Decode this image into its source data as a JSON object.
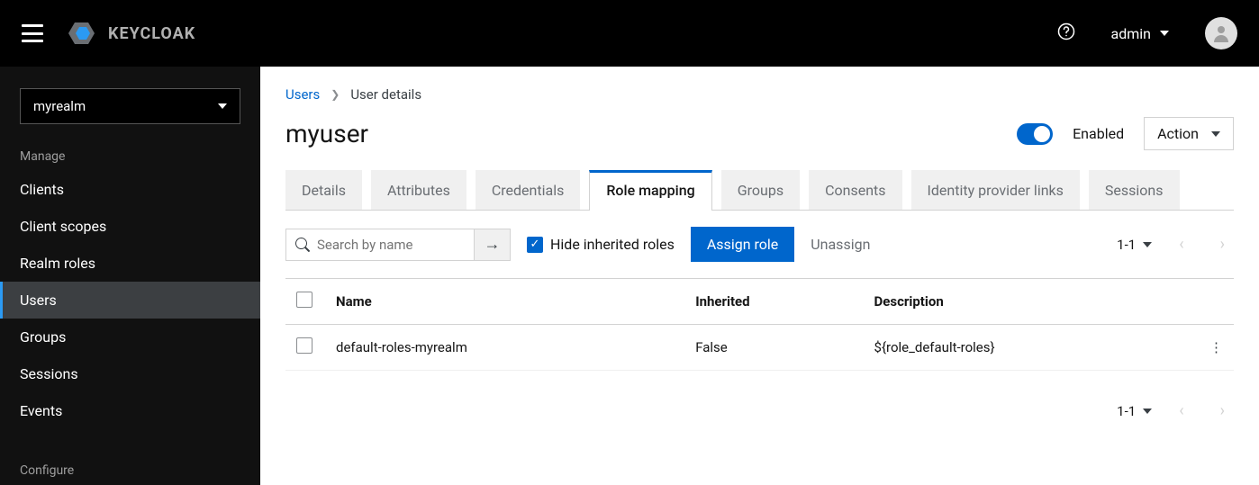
{
  "header": {
    "brand_text": "KEYCLOAK",
    "username": "admin"
  },
  "sidebar": {
    "realm": "myrealm",
    "sections": [
      {
        "heading": "Manage",
        "items": [
          "Clients",
          "Client scopes",
          "Realm roles",
          "Users",
          "Groups",
          "Sessions",
          "Events"
        ],
        "active": "Users"
      },
      {
        "heading": "Configure",
        "items": []
      }
    ]
  },
  "breadcrumb": {
    "link": "Users",
    "current": "User details"
  },
  "page": {
    "title": "myuser",
    "enabled_label": "Enabled",
    "action_label": "Action"
  },
  "tabs": {
    "items": [
      "Details",
      "Attributes",
      "Credentials",
      "Role mapping",
      "Groups",
      "Consents",
      "Identity provider links",
      "Sessions"
    ],
    "active": "Role mapping"
  },
  "toolbar": {
    "search_placeholder": "Search by name",
    "hide_inherited_label": "Hide inherited roles",
    "assign_label": "Assign role",
    "unassign_label": "Unassign",
    "page_range": "1-1"
  },
  "table": {
    "columns": [
      "Name",
      "Inherited",
      "Description"
    ],
    "rows": [
      {
        "name": "default-roles-myrealm",
        "inherited": "False",
        "description": "${role_default-roles}"
      }
    ]
  },
  "footer": {
    "page_range": "1-1"
  }
}
